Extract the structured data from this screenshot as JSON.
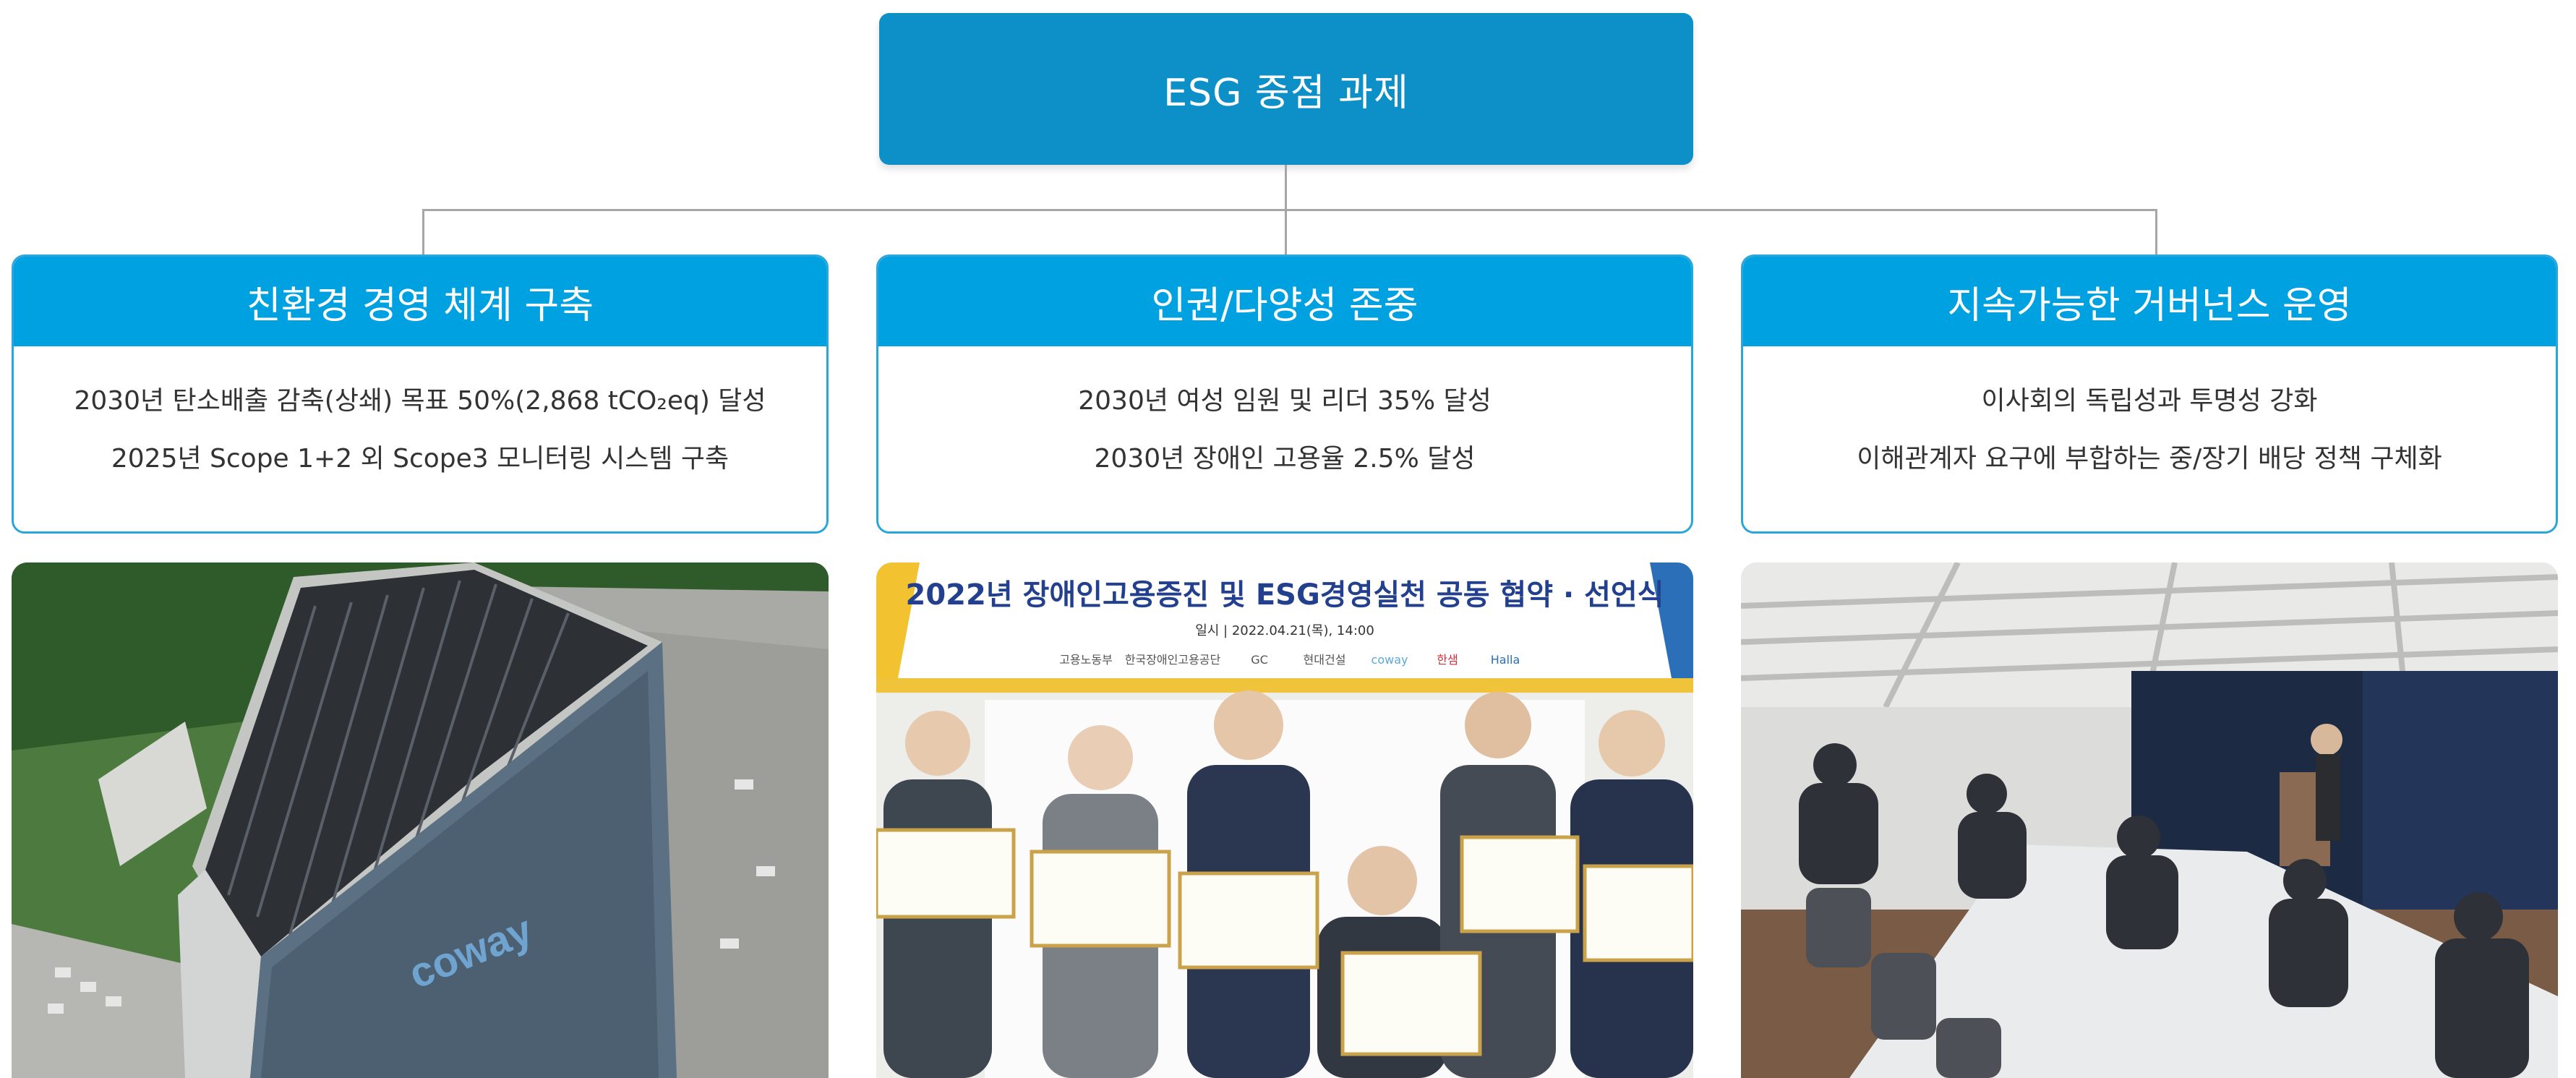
{
  "root": {
    "title": "ESG 중점 과제"
  },
  "pillars": [
    {
      "title": "친환경 경영 체계 구축",
      "items": [
        "2030년 탄소배출 감축(상쇄) 목표 50%(2,868 tCO₂eq) 달성",
        "2025년 Scope 1+2 외 Scope3 모니터링 시스템 구축"
      ]
    },
    {
      "title": "인권/다양성 존중",
      "items": [
        "2030년 여성 임원 및 리더 35% 달성",
        "2030년 장애인 고용율 2.5% 달성"
      ]
    },
    {
      "title": "지속가능한 거버넌스 운영",
      "items": [
        "이사회의 독립성과 투명성 강화",
        "이해관계자 요구에 부합하는 중/장기 배당 정책 구체화"
      ]
    }
  ],
  "photo2": {
    "banner_title": "2022년 장애인고용증진 및 ESG경영실천 공동 협약 · 선언식",
    "banner_date": "일시 | 2022.04.21(목), 14:00",
    "logos": [
      "고용노동부",
      "한국장애인고용공단",
      "GC",
      "현대건설",
      "coway",
      "한샘",
      "Halla"
    ]
  },
  "photo1": {
    "building_logo": "coway"
  },
  "colors": {
    "root_box": "#0c90c7",
    "pillar_header": "#00a1e0",
    "pillar_border": "#2aa6dc",
    "connector": "#a6a6a6"
  }
}
